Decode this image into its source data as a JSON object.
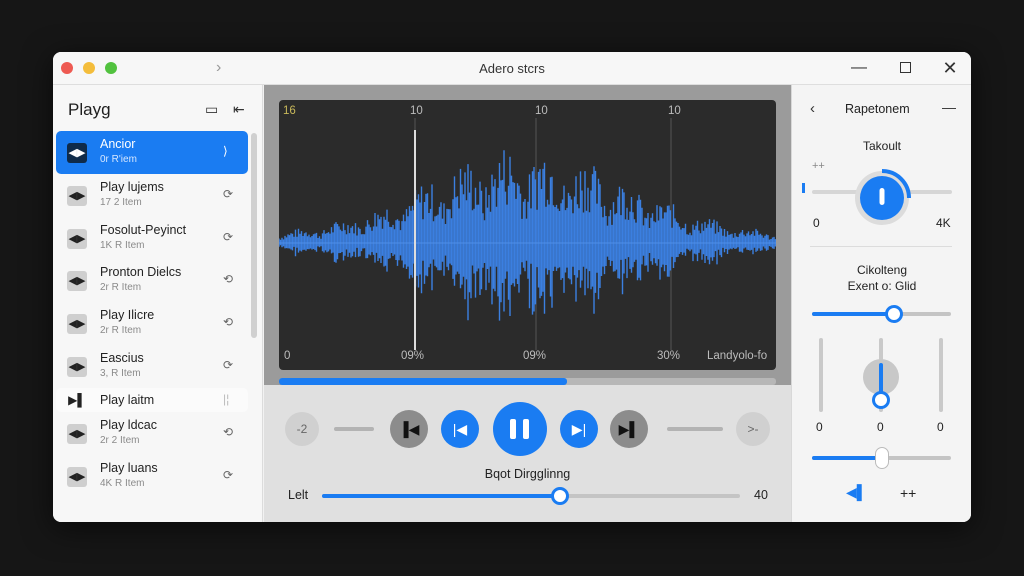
{
  "window": {
    "title": "Adero stcrs"
  },
  "sidebar": {
    "title": "Playg",
    "items": [
      {
        "name": "Ancior",
        "sub": "0r R'iem",
        "active": true
      },
      {
        "name": "Play lujems",
        "sub": "17 2 Item"
      },
      {
        "name": "Fosolut-Peyinct",
        "sub": "1K R Item"
      },
      {
        "name": "Pronton Dielcs",
        "sub": "2r R Item"
      },
      {
        "name": "Play Ilicre",
        "sub": "2r R Item"
      },
      {
        "name": "Eascius",
        "sub": "3, R Item"
      },
      {
        "name": "Play laitm",
        "sub": ""
      },
      {
        "name": "Play ldcac",
        "sub": "2r 2 Item"
      },
      {
        "name": "Play luans",
        "sub": "4K R Item"
      }
    ]
  },
  "waveform": {
    "top_labels": [
      "16",
      "10",
      "10",
      "10"
    ],
    "bottom_labels": [
      "0",
      "09%",
      "09%",
      "30%",
      "Landyolo-fo"
    ],
    "progress": 0.58
  },
  "transport": {
    "left_ghost": "-2",
    "right_ghost": ">-",
    "volume_title": "Bqot Dirgglinng",
    "volume_left": "Lelt",
    "volume_right": "40",
    "volume_value": 0.57
  },
  "right_panel": {
    "title": "Rapetonem",
    "knob_label": "Takoult",
    "knob_min": "0",
    "knob_max": "4K",
    "small_plus": "++",
    "section_label_1": "Cikolteng",
    "section_label_2": "Exent o: Glid",
    "slider1_value": 0.59,
    "eq_values": [
      "0",
      "0",
      "0"
    ],
    "slider2_value": 0.5,
    "bottom_plus": "++"
  },
  "colors": {
    "accent": "#1a7cf2",
    "waveform": "#3b7fe0",
    "wave_bg": "#2b2b2b"
  }
}
